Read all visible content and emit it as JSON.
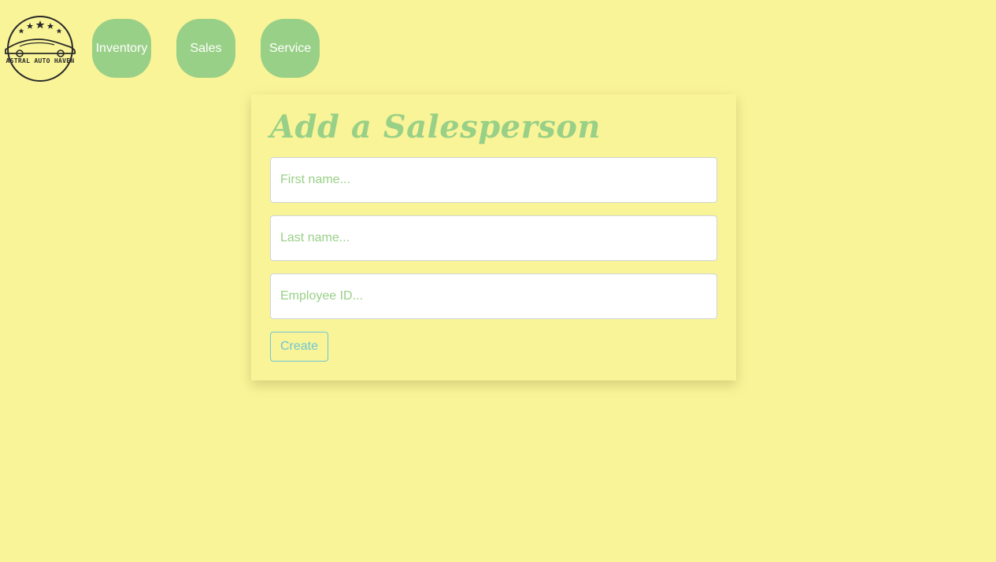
{
  "brand": {
    "logo_icon": "astral-auto-haven-logo",
    "logo_text": "ASTRAL AUTO HAVEN"
  },
  "nav": {
    "items": [
      {
        "label": "Inventory"
      },
      {
        "label": "Sales"
      },
      {
        "label": "Service"
      }
    ]
  },
  "form": {
    "title": "Add a Salesperson",
    "first_name": {
      "value": "",
      "placeholder": "First name..."
    },
    "last_name": {
      "value": "",
      "placeholder": "Last name..."
    },
    "employee_id": {
      "value": "",
      "placeholder": "Employee ID..."
    },
    "submit_label": "Create"
  },
  "colors": {
    "background": "#f9f497",
    "accent_green": "#99d087",
    "button_outline": "#6ec6d8",
    "logo_ink": "#2a2a2a"
  }
}
